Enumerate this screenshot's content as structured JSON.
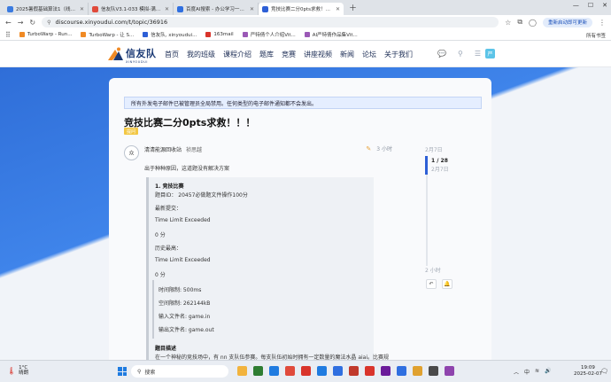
{
  "browser": {
    "tabs": [
      {
        "label": "2025暑假基础算法1（线上）",
        "color": "#3b7be0",
        "active": false
      },
      {
        "label": "信友队V3.1-033 模拟-满分作业",
        "color": "#e04a3b",
        "active": false
      },
      {
        "label": "百度AI搜索 - 办公学习一站解决",
        "color": "#2f6fe0",
        "active": false
      },
      {
        "label": "竞技比赛二分0pts求救！！！",
        "color": "#2d5fd6",
        "active": true
      }
    ],
    "url": "discourse.xinyoudui.com/t/topic/36916",
    "update_button": "重新启动即可更新",
    "bookmarks": [
      {
        "label": "TurboWarp - Run...",
        "color": "#f08a24"
      },
      {
        "label": "TurboWarp - 让 S...",
        "color": "#f08a24"
      },
      {
        "label": "信友队, xinyoudui...",
        "color": "#2d5fd6"
      },
      {
        "label": "163mail",
        "color": "#d9342b"
      },
      {
        "label": "严特倩个人介绍Vit...",
        "color": "#9b59b6"
      },
      {
        "label": "AI严特倩作品集Vit...",
        "color": "#9b59b6"
      }
    ],
    "all_bookmarks": "所有书签"
  },
  "site": {
    "logo_text": "信友队",
    "logo_sub": "XINYOUDUI",
    "nav": [
      "首页",
      "我的班级",
      "课程介绍",
      "题库",
      "竞赛",
      "讲座视频",
      "新闻",
      "论坛",
      "关于我们"
    ],
    "user_initial": "严"
  },
  "topic": {
    "notice": "所有外发电子邮件已被管理员全局禁用。任何类型的电子邮件通知都不会发出。",
    "title": "竞技比赛二分0pts求救！！！",
    "tag": "提问",
    "author": "清清能源回收站",
    "author_alt": "祯思越",
    "time": "3 小时",
    "first_line": "出于种种原因，这道题没有解决方案",
    "quote": {
      "heading": "1. 竞技比赛",
      "problem_id": "题目ID： 20457必做题文件操作100分",
      "latest_label": "最新提交：",
      "latest_status": "Time Limit Exceeded",
      "latest_score": "0 分",
      "best_label": "历史最高：",
      "best_status": "Time Limit Exceeded",
      "best_score": "0 分",
      "limits": {
        "time": "时间限制: 500ms",
        "memory": "空间限制: 262144kB",
        "input": "输入文件名: game.in",
        "output": "输出文件名: game.out"
      },
      "desc_heading": "题目描述",
      "desc_line": "在一个神秘的竞技场中，有 nn 支队伍参赛。每支队伍初始时拥有一定数量的魔法水晶 aiai。比赛规"
    }
  },
  "timeline": {
    "top_date": "2月7日",
    "position": "1 / 28",
    "position_date": "2月7日",
    "bottom": "2 小时"
  },
  "taskbar": {
    "temp": "1°C",
    "weather": "晴朗",
    "search_placeholder": "搜索",
    "time": "19:09",
    "date": "2025-02-07",
    "apps": [
      "#f2b33d",
      "#2e7d32",
      "#1f7be0",
      "#e04a3b",
      "#d9342b",
      "#1f7be0",
      "#2f6fe0",
      "#c0392b",
      "#d9342b",
      "#6a1b9a",
      "#2f6fe0",
      "#e0a12f",
      "#4a4a4a",
      "#8e44ad"
    ]
  }
}
